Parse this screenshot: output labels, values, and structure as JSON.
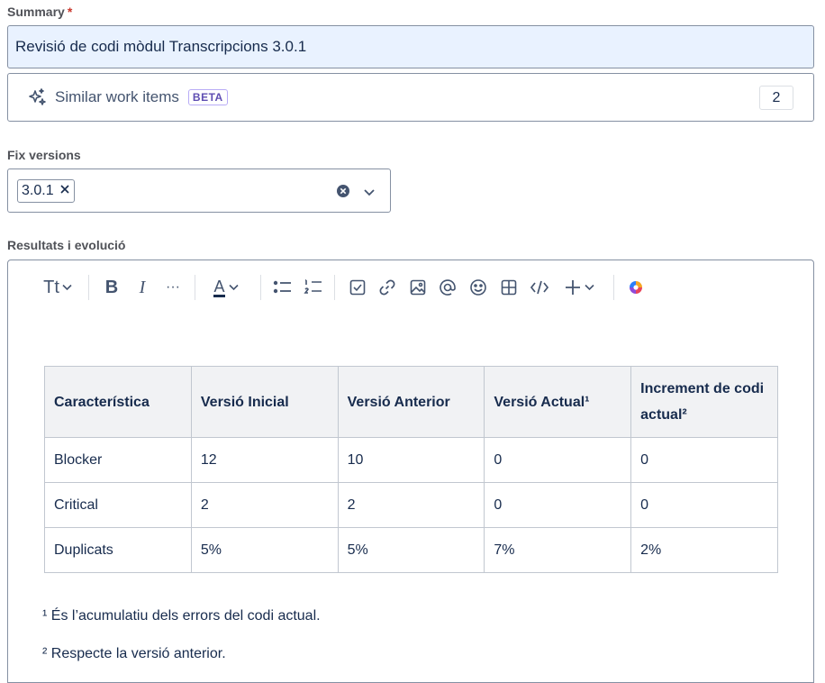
{
  "summary": {
    "label": "Summary",
    "required_mark": "*",
    "value": "Revisió de codi mòdul Transcripcions 3.0.1"
  },
  "similar": {
    "label": "Similar work items",
    "badge": "BETA",
    "count": "2"
  },
  "fix_versions": {
    "label": "Fix versions",
    "selected": "3.0.1"
  },
  "resultats": {
    "label": "Resultats i evolució",
    "toolbar": {
      "text_style": "Tt",
      "bold": "B",
      "italic": "I",
      "more": "···",
      "text_color": "A"
    },
    "table": {
      "headers": [
        "Característica",
        "Versió Inicial",
        "Versió Anterior",
        "Versió Actual¹",
        "Increment de codi actual²"
      ],
      "rows": [
        [
          "Blocker",
          "12",
          "10",
          "0",
          "0"
        ],
        [
          "Critical",
          "2",
          "2",
          "0",
          "0"
        ],
        [
          "Duplicats",
          "5%",
          "5%",
          "7%",
          "2%"
        ]
      ]
    },
    "footnotes": [
      "¹ És l’acumulatiu dels errors del codi actual.",
      "² Respecte la versió anterior."
    ]
  },
  "colors": {
    "accent": "#e9f2ff",
    "badge": "#5e4db2",
    "required": "#c9372c"
  }
}
